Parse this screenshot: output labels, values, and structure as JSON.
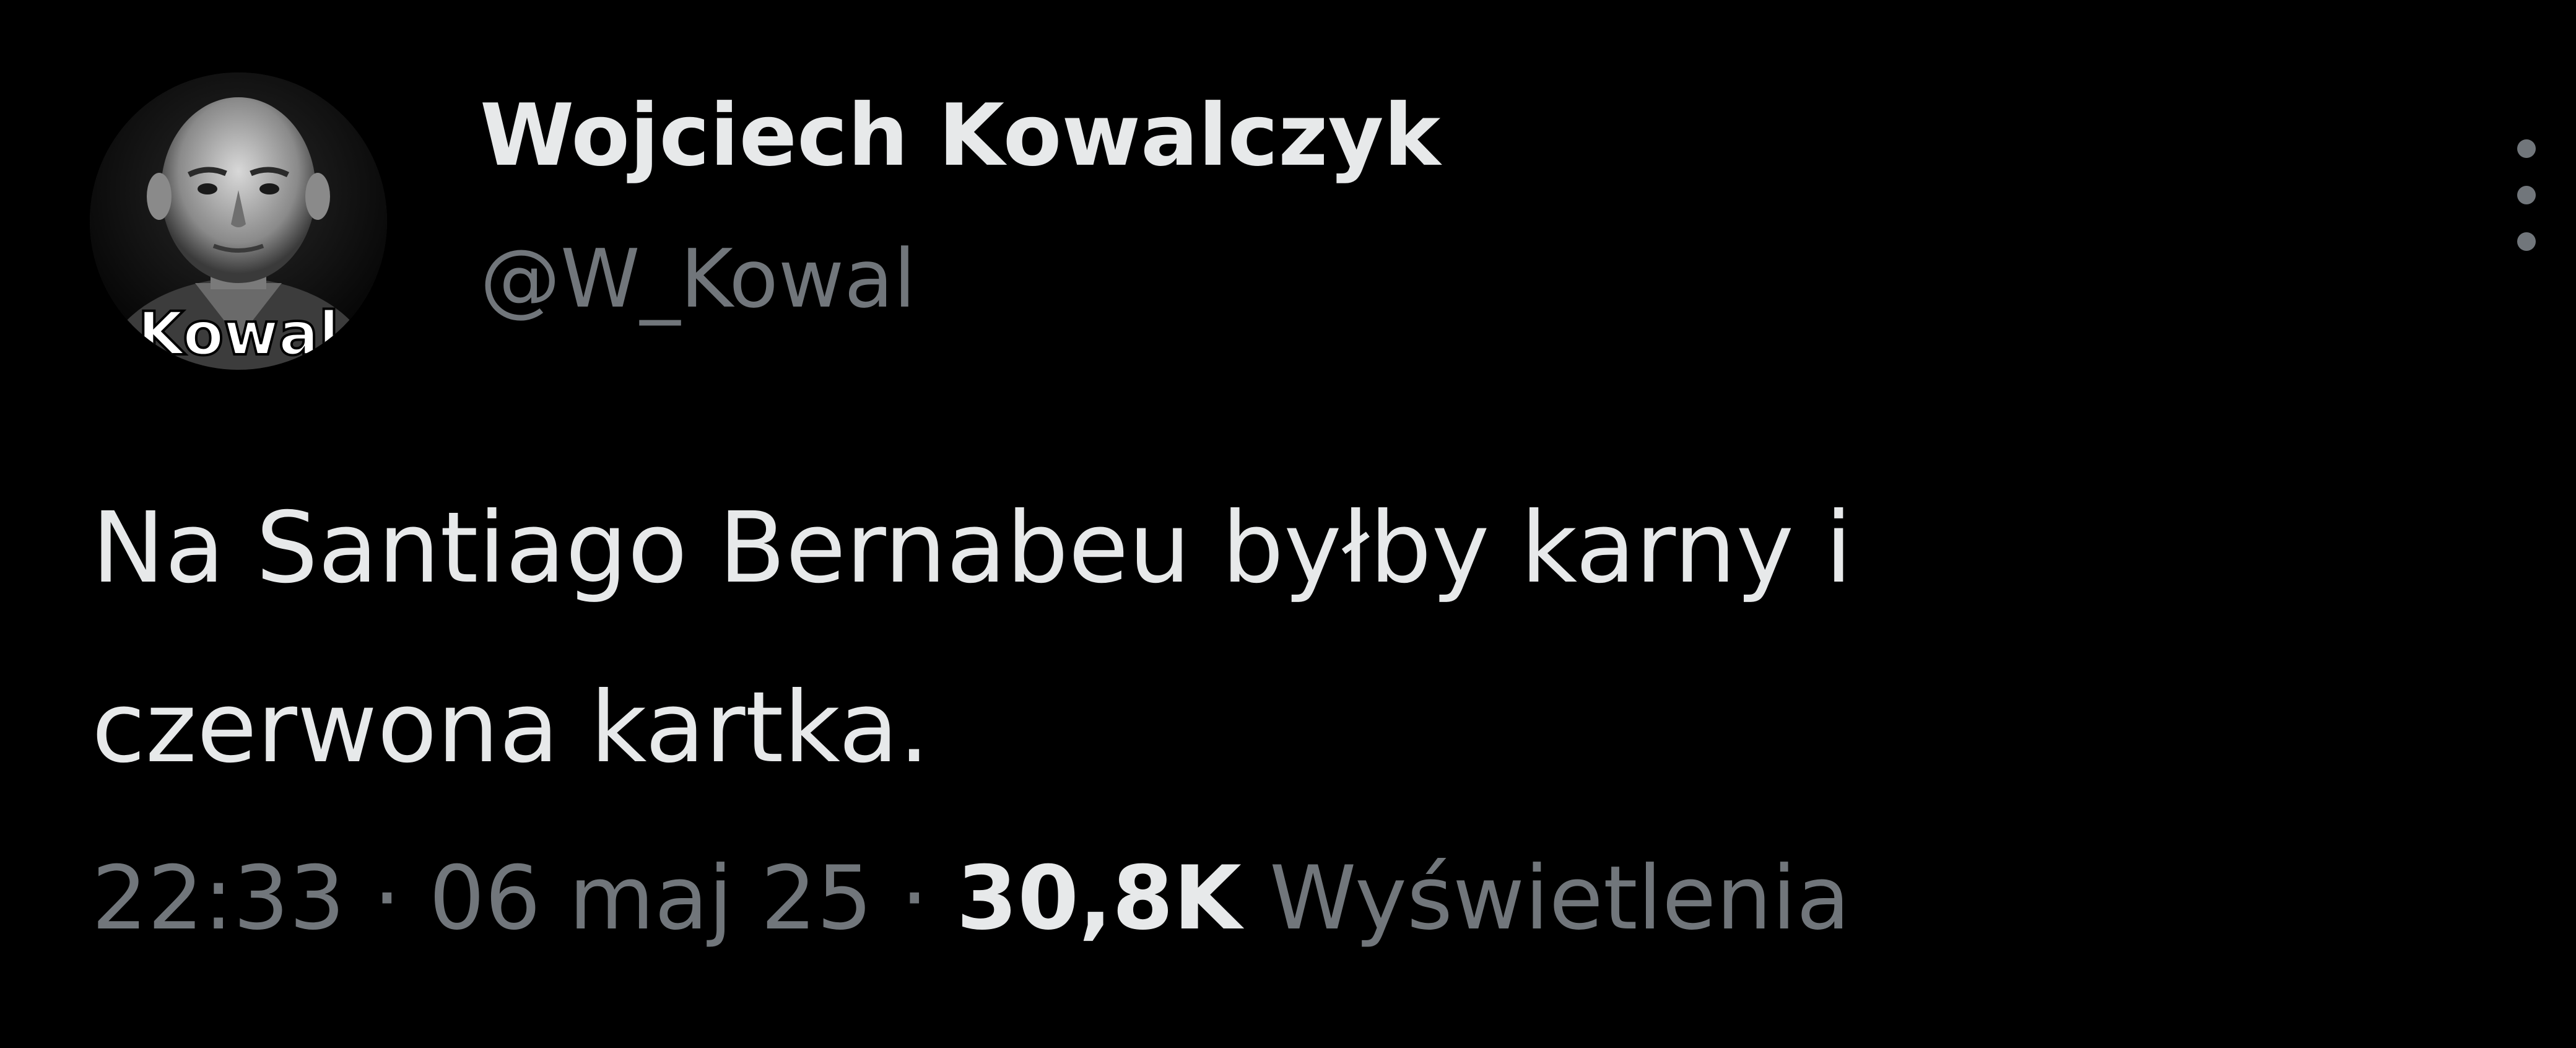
{
  "tweet": {
    "author": {
      "display_name": "Wojciech Kowalczyk",
      "handle": "@W_Kowal",
      "avatar_overlay_text": "Kowal"
    },
    "text_lines": [
      "Na Santiago Bernabeu byłby karny i",
      "czerwona kartka."
    ],
    "meta": {
      "time": "22:33",
      "separator": "·",
      "date": "06 maj 25",
      "views_count": "30,8K",
      "views_label": "Wyświetlenia"
    },
    "more_icon": "more-vertical-icon"
  },
  "colors": {
    "background": "#000000",
    "primary_text": "#e7e9ea",
    "secondary_text": "#71767b"
  }
}
